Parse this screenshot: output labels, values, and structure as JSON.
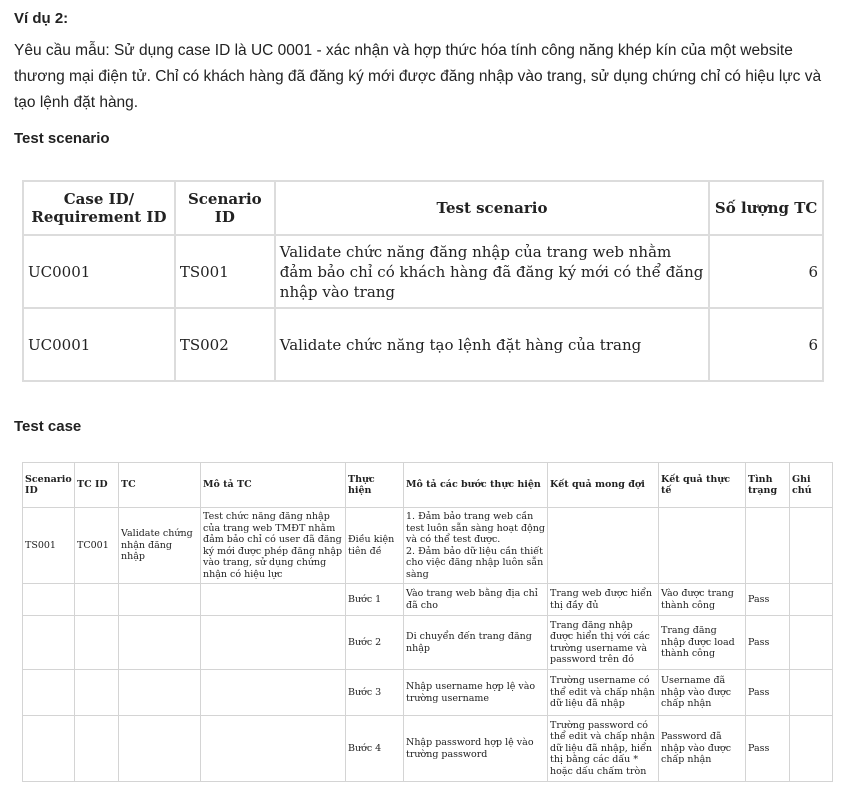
{
  "heading": "Ví dụ 2:",
  "intro": "Yêu cầu mẫu: Sử dụng case ID là UC 0001 - xác nhận và hợp thức hóa tính công năng khép kín của một website thương mại điện tử. Chỉ có khách hàng đã đăng ký mới được đăng nhập vào trang, sử dụng chứng chỉ có hiệu lực và tạo lệnh đặt hàng.",
  "scenario_heading": "Test scenario",
  "scenario_table": {
    "headers": [
      "Case ID/ Requirement ID",
      "Scenario ID",
      "Test scenario",
      "Số lượng TC"
    ],
    "rows": [
      [
        "UC0001",
        "TS001",
        "Validate chức năng đăng nhập của trang web nhằm đảm bảo chỉ có khách hàng đã đăng ký mới có thể đăng nhập vào trang",
        "6"
      ],
      [
        "UC0001",
        "TS002",
        "Validate chức năng tạo lệnh đặt hàng của trang",
        "6"
      ]
    ]
  },
  "case_heading": "Test case",
  "case_table": {
    "headers": [
      "Scenario ID",
      "TC ID",
      "TC",
      "Mô tả TC",
      "Thực hiện",
      "Mô tả các bước thực hiện",
      "Kết quả mong đợi",
      "Kết quả thực tế",
      "Tình trạng",
      "Ghi chú"
    ],
    "rows": [
      [
        "TS001",
        "TC001",
        "Validate chứng nhận đăng nhập",
        "Test chức năng đăng nhập của trang web TMĐT nhằm đảm bảo chỉ có user đã đăng ký mới được phép đăng nhập vào trang, sử dụng chứng nhận có hiệu lực",
        "Điều kiện tiên đề",
        "1. Đảm bảo trang web cần test luôn sẵn sàng hoạt động và có thể test được.\n2. Đảm bảo dữ liệu cần thiết cho việc đăng nhập luôn sẵn sàng",
        "",
        "",
        "",
        ""
      ],
      [
        "",
        "",
        "",
        "",
        "Bước 1",
        "Vào trang web bằng địa chỉ đã cho",
        "Trang web được hiển thị đầy đủ",
        "Vào được trang thành công",
        "Pass",
        ""
      ],
      [
        "",
        "",
        "",
        "",
        "Bước 2",
        "Di chuyển đến trang đăng nhập",
        "Trang đăng nhập được hiển thị với các trường username và password trên đó",
        "Trang đăng nhập được load thành công",
        "Pass",
        ""
      ],
      [
        "",
        "",
        "",
        "",
        "Bước 3",
        "Nhập username hợp lệ vào trường username",
        "Trường username có thể edit và chấp nhận dữ liệu đã nhập",
        "Username đã nhập vào được chấp nhận",
        "Pass",
        ""
      ],
      [
        "",
        "",
        "",
        "",
        "Bước 4",
        "Nhập password hợp lệ vào trường password",
        "Trường password có thể edit và chấp nhận dữ liệu đã nhập, hiển thị bằng các dấu * hoặc dấu chấm tròn",
        "Password đã nhập vào được chấp nhận",
        "Pass",
        ""
      ]
    ]
  }
}
